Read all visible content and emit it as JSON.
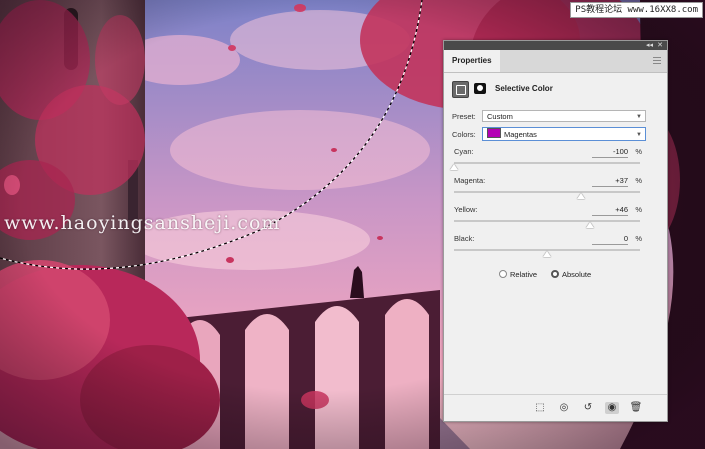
{
  "watermarks": {
    "site_badge": "PS教程论坛 www.16XX8.com",
    "overlay_text": "www.haoyingsansheji.com"
  },
  "panel": {
    "tab_label": "Properties",
    "adjustment_title": "Selective Color",
    "preset": {
      "label": "Preset:",
      "value": "Custom"
    },
    "colors": {
      "label": "Colors:",
      "value": "Magentas",
      "swatch_color": "#b400b4"
    },
    "sliders": [
      {
        "label": "Cyan:",
        "value": "-100",
        "unit": "%",
        "level": -100
      },
      {
        "label": "Magenta:",
        "value": "+37",
        "unit": "%",
        "level": 37
      },
      {
        "label": "Yellow:",
        "value": "+46",
        "unit": "%",
        "level": 46
      },
      {
        "label": "Black:",
        "value": "0",
        "unit": "%",
        "level": 0
      }
    ],
    "mode_options": {
      "relative": "Relative",
      "absolute": "Absolute",
      "selected": "absolute"
    },
    "bottom_icons": [
      "clip-to-layer-icon",
      "view-previous-state-icon",
      "reset-icon",
      "toggle-visibility-icon",
      "trash-icon"
    ]
  },
  "colors": {
    "panel_bg": "#f0f0f0",
    "titlebar": "#4a4a4a",
    "sky_top": "#7d82c8",
    "sky_bottom": "#f2a7c0",
    "foliage": "#c2345c"
  }
}
